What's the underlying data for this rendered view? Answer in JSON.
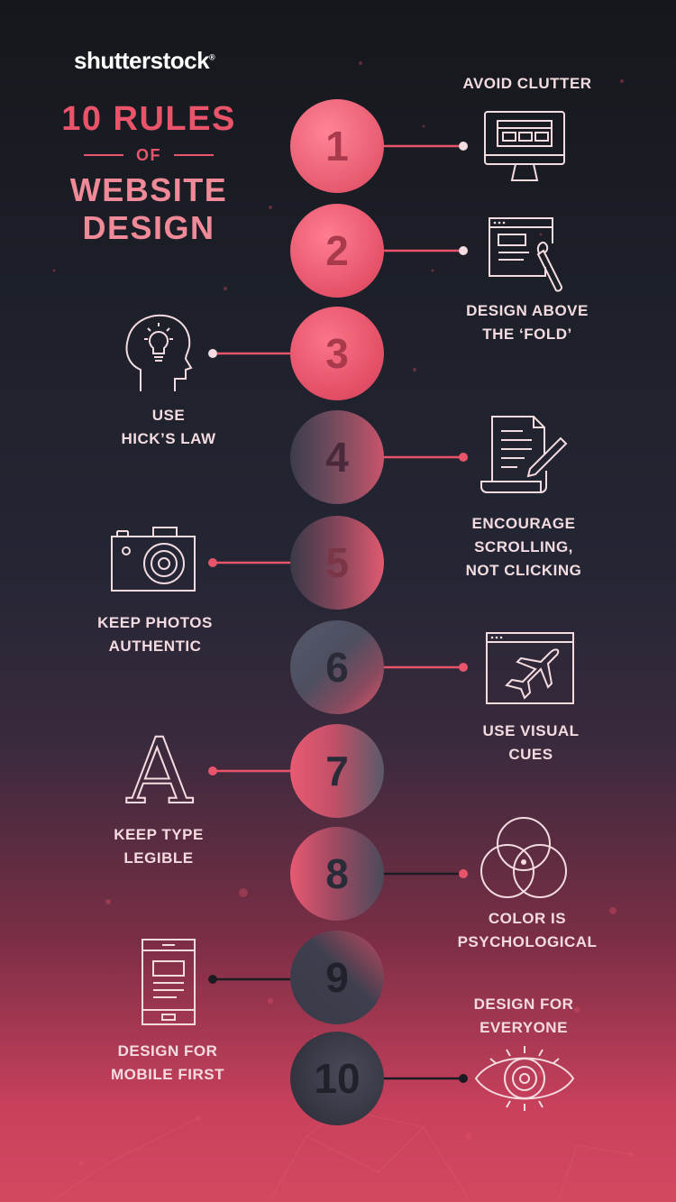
{
  "brand": {
    "logo_text": "shutterstock"
  },
  "header": {
    "line1": "10 RULES",
    "line2": "OF",
    "line3": "WEBSITE",
    "line4": "DESIGN"
  },
  "rules": [
    {
      "number": "1",
      "label_lines": [
        "AVOID CLUTTER"
      ],
      "icon": "desktop-monitor-icon"
    },
    {
      "number": "2",
      "label_lines": [
        "DESIGN ABOVE",
        "THE ‘FOLD’"
      ],
      "icon": "browser-paintbrush-icon"
    },
    {
      "number": "3",
      "label_lines": [
        "USE",
        "HICK’S LAW"
      ],
      "icon": "head-lightbulb-icon"
    },
    {
      "number": "4",
      "label_lines": [
        "ENCOURAGE",
        "SCROLLING,",
        "NOT CLICKING"
      ],
      "icon": "scroll-document-pen-icon"
    },
    {
      "number": "5",
      "label_lines": [
        "KEEP PHOTOS",
        "AUTHENTIC"
      ],
      "icon": "camera-icon"
    },
    {
      "number": "6",
      "label_lines": [
        "USE VISUAL",
        "CUES"
      ],
      "icon": "browser-airplane-icon"
    },
    {
      "number": "7",
      "label_lines": [
        "KEEP TYPE",
        "LEGIBLE"
      ],
      "icon": "serif-letter-a-icon"
    },
    {
      "number": "8",
      "label_lines": [
        "COLOR IS",
        "PSYCHOLOGICAL"
      ],
      "icon": "venn-circles-icon"
    },
    {
      "number": "9",
      "label_lines": [
        "DESIGN FOR",
        "MOBILE FIRST"
      ],
      "icon": "mobile-phone-icon"
    },
    {
      "number": "10",
      "label_lines": [
        "DESIGN FOR",
        "EVERYONE"
      ],
      "icon": "eye-icon"
    }
  ],
  "icon_letter": "A",
  "colors": {
    "accent": "#e9546b",
    "accent_light": "#f08a98",
    "text_light": "#f3dbe0",
    "icon_stroke": "#f3dbe0"
  }
}
